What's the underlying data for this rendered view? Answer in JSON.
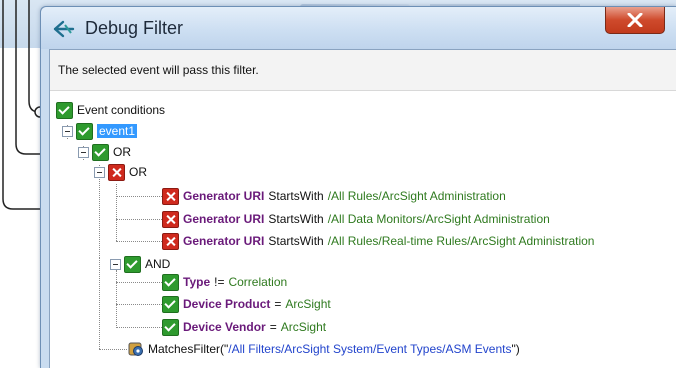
{
  "window": {
    "title": "Debug Filter",
    "app_icon": "debug-filter-icon",
    "close_icon": "close-icon"
  },
  "description": "The selected event will pass this filter.",
  "tree": {
    "root_label": "Event conditions",
    "event_label": "event1",
    "or_label": "OR",
    "inner_or_label": "OR",
    "and_label": "AND",
    "or_conditions": [
      {
        "field": "Generator URI",
        "op": "StartsWith",
        "value": "/All Rules/ArcSight Administration",
        "state": "fail"
      },
      {
        "field": "Generator URI",
        "op": "StartsWith",
        "value": "/All Data Monitors/ArcSight Administration",
        "state": "fail"
      },
      {
        "field": "Generator URI",
        "op": "StartsWith",
        "value": "/All Rules/Real-time Rules/ArcSight Administration",
        "state": "fail"
      }
    ],
    "and_conditions": [
      {
        "field": "Type",
        "op": "!=",
        "value": "Correlation",
        "state": "pass"
      },
      {
        "field": "Device Product",
        "op": "=",
        "value": "ArcSight",
        "state": "pass"
      },
      {
        "field": "Device Vendor",
        "op": "=",
        "value": "ArcSight",
        "state": "pass"
      }
    ],
    "matches_filter": {
      "fn_open": "MatchesFilter(\"",
      "path": "/All Filters/ArcSight System/Event Types/ASM Events",
      "fn_close": "\")"
    }
  },
  "colors": {
    "pass": "#2e9a2e",
    "fail": "#cf2a1e",
    "selection": "#3399ff",
    "field": "#6a1a7a",
    "value": "#2f7a1f",
    "path": "#2244cc"
  }
}
